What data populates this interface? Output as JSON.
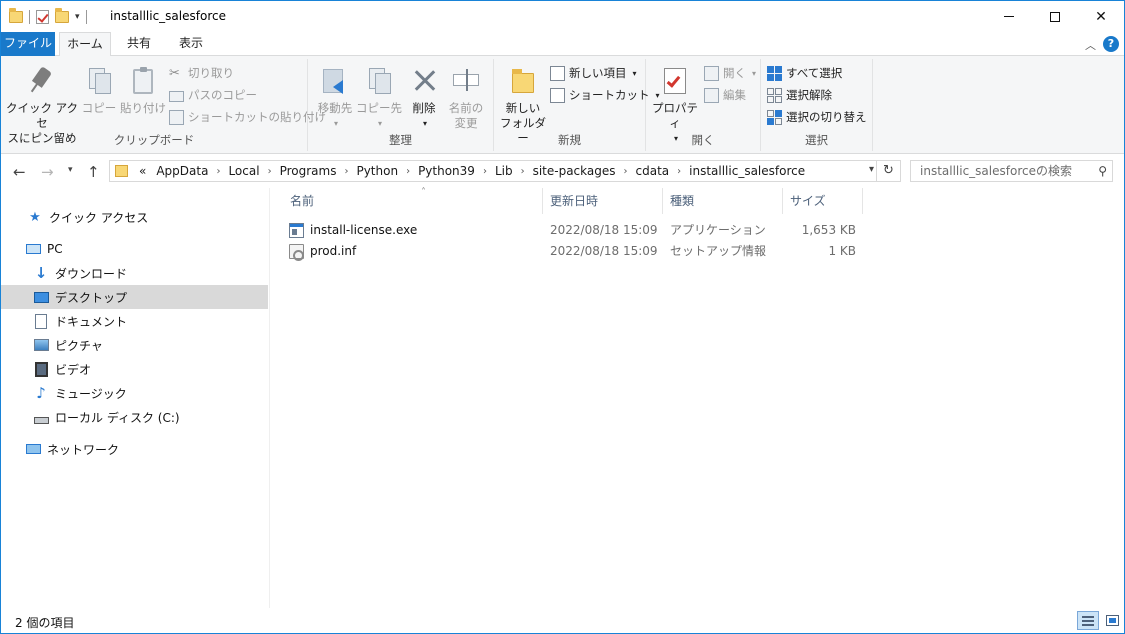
{
  "window": {
    "title": "installlic_salesforce"
  },
  "ribbon_tabs": {
    "file": "ファイル",
    "home": "ホーム",
    "share": "共有",
    "view": "表示"
  },
  "ribbon": {
    "clipboard": {
      "pin_quick_access": "クイック アクセス\nにピン留め",
      "pin_line1": "クイック アクセ",
      "pin_line2": "スにピン留め",
      "copy": "コピー",
      "paste": "貼り付け",
      "cut": "切り取り",
      "copy_path": "パスのコピー",
      "paste_shortcut": "ショートカットの貼り付け",
      "label": "クリップボード"
    },
    "organize": {
      "move_to": "移動先",
      "copy_to": "コピー先",
      "delete": "削除",
      "rename_line1": "名前の",
      "rename_line2": "変更",
      "label": "整理"
    },
    "new": {
      "new_item": "新しい項目",
      "shortcut": "ショートカット",
      "new_folder_line1": "新しい",
      "new_folder_line2": "フォルダー",
      "label": "新規"
    },
    "open": {
      "properties": "プロパティ",
      "open": "開く",
      "edit": "編集",
      "label": "開く"
    },
    "select": {
      "select_all": "すべて選択",
      "select_none": "選択解除",
      "invert": "選択の切り替え",
      "label": "選択"
    }
  },
  "address": {
    "overflow": "«",
    "crumbs": [
      "AppData",
      "Local",
      "Programs",
      "Python",
      "Python39",
      "Lib",
      "site-packages",
      "cdata",
      "installlic_salesforce"
    ],
    "search_placeholder": "installlic_salesforceの検索"
  },
  "nav_pane": {
    "items": [
      {
        "label": "クイック アクセス",
        "icon": "star-icon"
      },
      {
        "label": "PC",
        "icon": "pc-icon"
      },
      {
        "label": "ダウンロード",
        "icon": "download-icon"
      },
      {
        "label": "デスクトップ",
        "icon": "desktop-icon"
      },
      {
        "label": "ドキュメント",
        "icon": "document-icon"
      },
      {
        "label": "ピクチャ",
        "icon": "picture-icon"
      },
      {
        "label": "ビデオ",
        "icon": "video-icon"
      },
      {
        "label": "ミュージック",
        "icon": "music-icon"
      },
      {
        "label": "ローカル ディスク (C:)",
        "icon": "drive-icon"
      },
      {
        "label": "ネットワーク",
        "icon": "network-icon"
      }
    ]
  },
  "file_list": {
    "columns": [
      "名前",
      "更新日時",
      "種類",
      "サイズ"
    ],
    "rows": [
      {
        "name": "install-license.exe",
        "modified": "2022/08/18 15:09",
        "type": "アプリケーション",
        "size": "1,653 KB",
        "icon": "exe-icon"
      },
      {
        "name": "prod.inf",
        "modified": "2022/08/18 15:09",
        "type": "セットアップ情報",
        "size": "1 KB",
        "icon": "inf-icon"
      }
    ]
  },
  "status": {
    "item_count": "2 個の項目"
  },
  "colors": {
    "accent": "#1979ca",
    "selection": "#d9d9d9",
    "ribbon_bg": "#f5f6f7"
  }
}
